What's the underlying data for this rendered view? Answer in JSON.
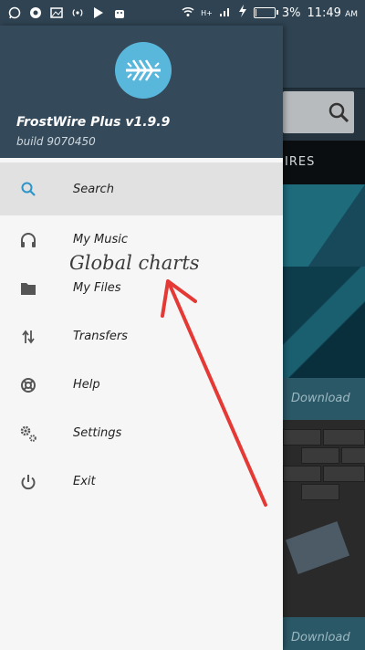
{
  "status_bar": {
    "battery": "3%",
    "time": "11:49",
    "ampm": "AM",
    "network": "H+",
    "battery_level": 0.03
  },
  "drawer": {
    "app_name": "FrostWire Plus v1.9.9",
    "build": "build 9070450",
    "menu": [
      {
        "label": "Search",
        "icon": "search-icon",
        "active": true
      },
      {
        "label": "My Music",
        "icon": "headphones-icon"
      },
      {
        "label": "My Files",
        "icon": "folder-icon"
      },
      {
        "label": "Transfers",
        "icon": "transfers-icon"
      },
      {
        "label": "Help",
        "icon": "lifebuoy-icon"
      },
      {
        "label": "Settings",
        "icon": "settings-gears-icon"
      },
      {
        "label": "Exit",
        "icon": "power-icon"
      }
    ]
  },
  "background": {
    "tab_partial": "IRES",
    "download_label": "Download"
  },
  "annotation": {
    "text": "Global charts",
    "color": "#e53935"
  },
  "colors": {
    "header": "#34495a",
    "status": "#2f4352",
    "accent": "#2b95c9"
  }
}
